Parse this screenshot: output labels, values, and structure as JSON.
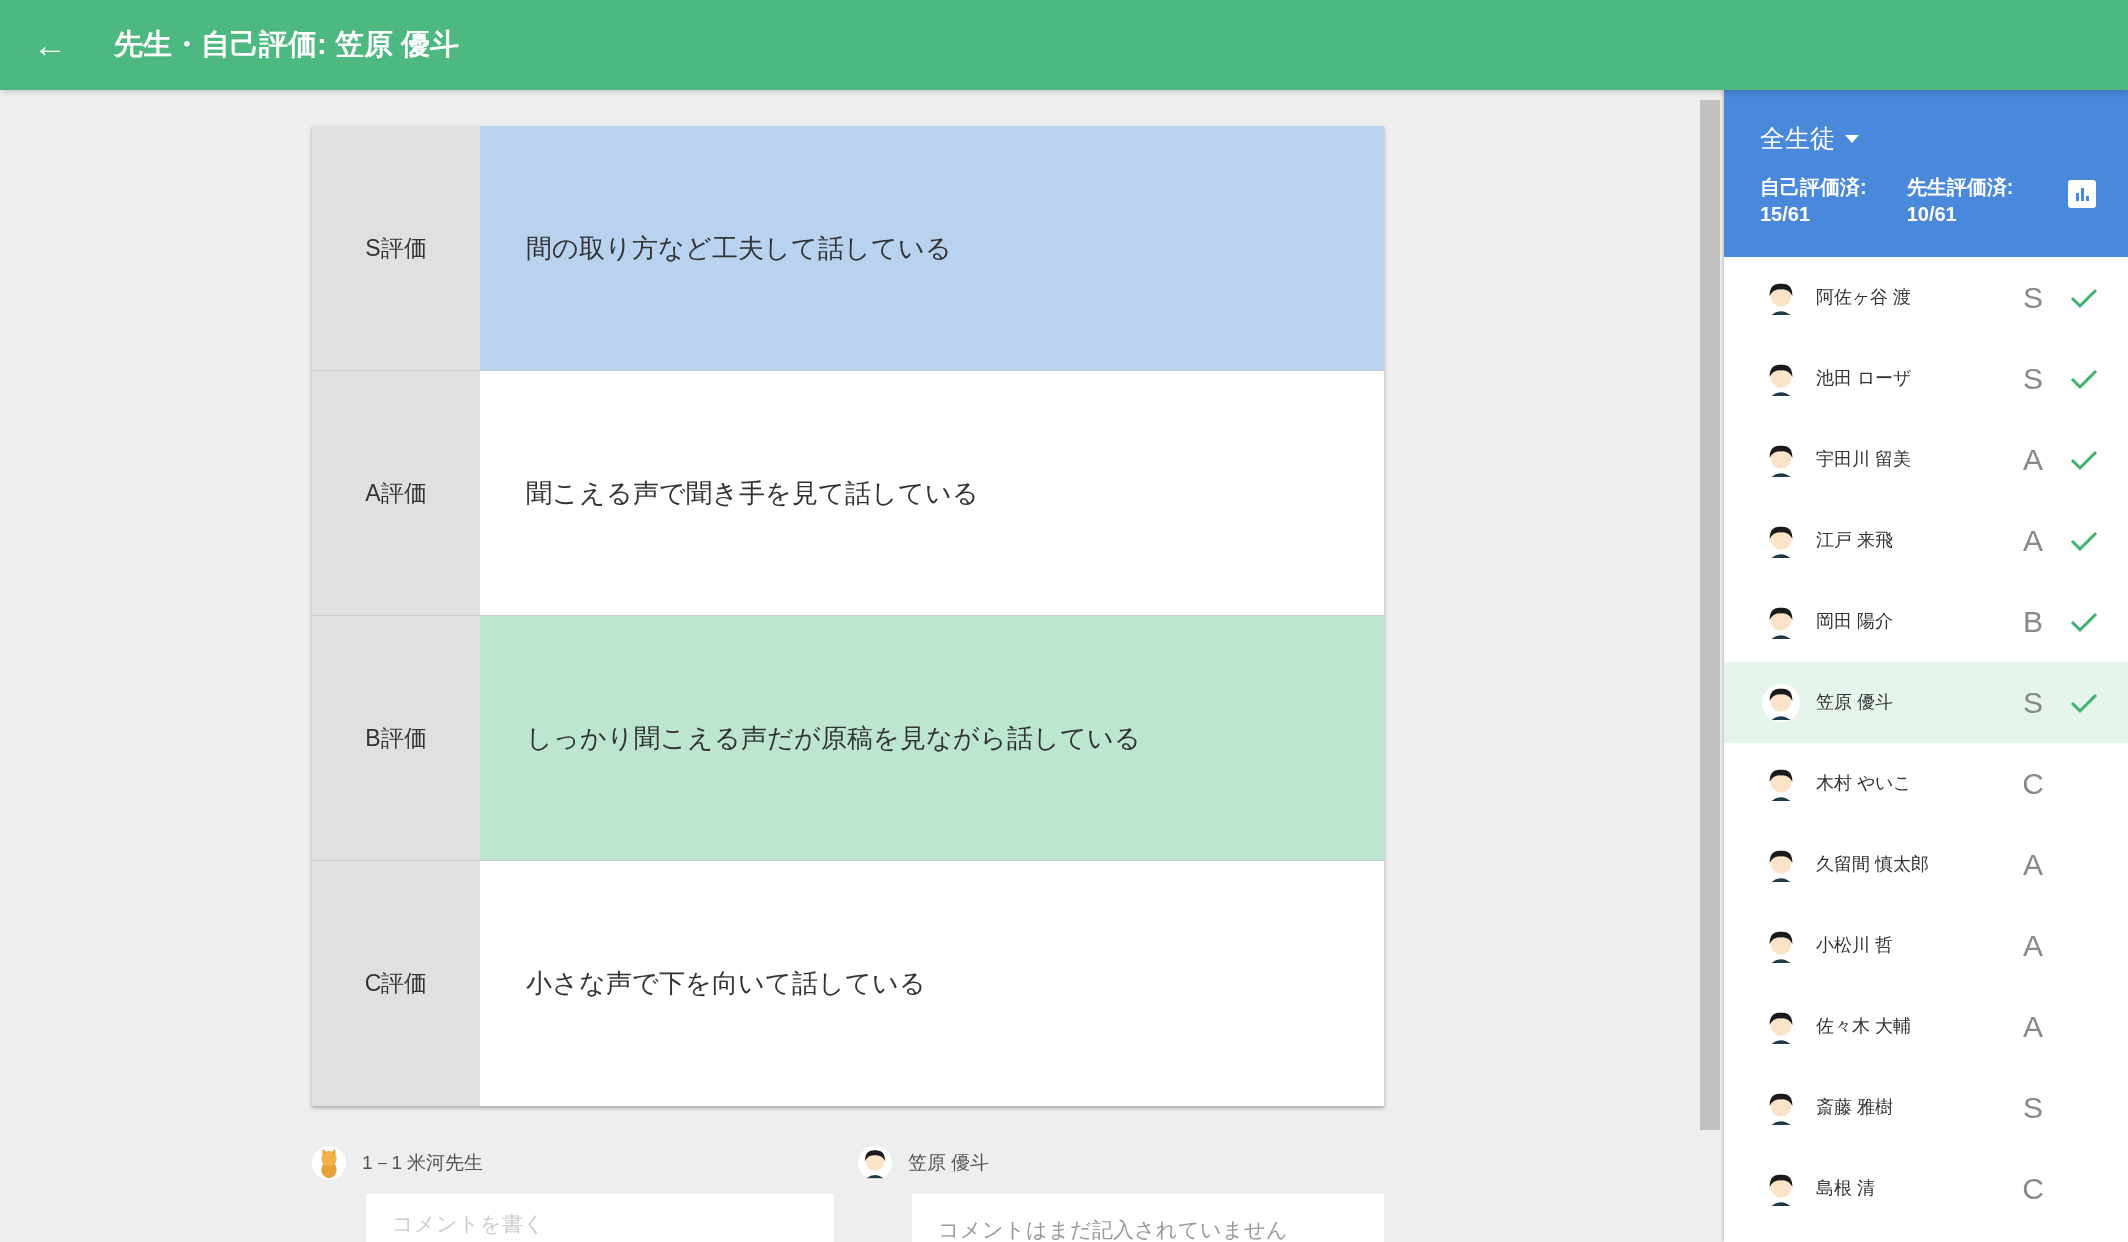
{
  "app_bar": {
    "back_icon": "←",
    "title": "先生・自己評価: 笠原 優斗"
  },
  "rubric": [
    {
      "grade": "S評価",
      "description": "間の取り方など工夫して話している",
      "color": "#b8d2f0"
    },
    {
      "grade": "A評価",
      "description": "聞こえる声で聞き手を見て話している"
    },
    {
      "grade": "B評価",
      "description": "しっかり聞こえる声だが原稿を見ながら話している",
      "color": "#bce6d0"
    },
    {
      "grade": "C評価",
      "description": "小さな声で下を向いて話している"
    }
  ],
  "comments": [
    {
      "kind": "teacher",
      "author": "1－1 米河先生",
      "placeholder": "コメントを書く"
    },
    {
      "kind": "student",
      "author": "笠原 優斗",
      "text": "コメントはまだ記入されていません"
    }
  ],
  "sidebar": {
    "filter": "全生徒",
    "stats": [
      {
        "label": "自己評価済:",
        "value": "15/61"
      },
      {
        "label": "先生評価済:",
        "value": "10/61"
      }
    ],
    "students": [
      {
        "name": "阿佐ヶ谷 渡",
        "grade": "S",
        "checked": true,
        "selected": false
      },
      {
        "name": "池田 ローザ",
        "grade": "S",
        "checked": true,
        "selected": false
      },
      {
        "name": "宇田川 留美",
        "grade": "A",
        "checked": true,
        "selected": false
      },
      {
        "name": "江戸 来飛",
        "grade": "A",
        "checked": true,
        "selected": false
      },
      {
        "name": "岡田 陽介",
        "grade": "B",
        "checked": true,
        "selected": false
      },
      {
        "name": "笠原 優斗",
        "grade": "S",
        "checked": true,
        "selected": true
      },
      {
        "name": "木村 やいこ",
        "grade": "C",
        "checked": false,
        "selected": false
      },
      {
        "name": "久留間 慎太郎",
        "grade": "A",
        "checked": false,
        "selected": false
      },
      {
        "name": "小松川 哲",
        "grade": "A",
        "checked": false,
        "selected": false
      },
      {
        "name": "佐々木 大輔",
        "grade": "A",
        "checked": false,
        "selected": false
      },
      {
        "name": "斎藤 雅樹",
        "grade": "S",
        "checked": false,
        "selected": false
      },
      {
        "name": "島根 清",
        "grade": "C",
        "checked": false,
        "selected": false
      }
    ]
  }
}
